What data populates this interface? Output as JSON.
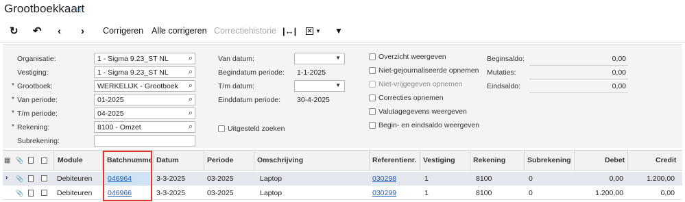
{
  "title": "Grootboekkaart",
  "toolbar": {
    "correct": "Corrigeren",
    "correct_all": "Alle corrigeren",
    "history": "Correctiehistorie"
  },
  "form": {
    "organisatie_label": "Organisatie:",
    "organisatie_value": "1 - Sigma 9.23_ST NL",
    "vestiging_label": "Vestiging:",
    "vestiging_value": "1 - Sigma 9.23_ST NL",
    "grootboek_label": "Grootboek:",
    "grootboek_value": "WERKELIJK - Grootboek",
    "van_periode_label": "Van periode:",
    "van_periode_value": "01-2025",
    "tm_periode_label": "T/m periode:",
    "tm_periode_value": "04-2025",
    "rekening_label": "Rekening:",
    "rekening_value": "8100 - Omzet",
    "subrekening_label": "Subrekening:",
    "subrekening_value": "",
    "van_datum_label": "Van datum:",
    "van_datum_value": "",
    "begindatum_label": "Begindatum periode:",
    "begindatum_value": "1-1-2025",
    "tm_datum_label": "T/m datum:",
    "tm_datum_value": "",
    "einddatum_label": "Einddatum periode:",
    "einddatum_value": "30-4-2025",
    "uitgesteld_label": "Uitgesteld zoeken",
    "overzicht_label": "Overzicht weergeven",
    "niet_gejourn_label": "Niet-gejournaliseerde opnemen",
    "niet_vrij_label": "Niet-vrijgegeven opnemen",
    "correcties_label": "Correcties opnemen",
    "valuta_label": "Valutagegevens weergeven",
    "begin_eind_label": "Begin- en eindsaldo weergeven",
    "beginsaldo_label": "Beginsaldo:",
    "beginsaldo_value": "0,00",
    "mutaties_label": "Mutaties:",
    "mutaties_value": "0,00",
    "eindsaldo_label": "Eindsaldo:",
    "eindsaldo_value": "0,00"
  },
  "grid": {
    "columns": [
      "Module",
      "Batchnumme",
      "Datum",
      "Periode",
      "Omschrijving",
      "Referentienr.",
      "Vestiging",
      "Rekening",
      "Subrekening",
      "Debet",
      "Credit"
    ],
    "rows": [
      {
        "module": "Debiteuren",
        "batch": "046964",
        "datum": "3-3-2025",
        "periode": "03-2025",
        "omschrijving": "Laptop",
        "ref": "030298",
        "vestiging": "1",
        "rekening": "8100",
        "subrekening": "0",
        "debet": "0,00",
        "credit": "1.200,00"
      },
      {
        "module": "Debiteuren",
        "batch": "046966",
        "datum": "3-3-2025",
        "periode": "03-2025",
        "omschrijving": "Laptop",
        "ref": "030299",
        "vestiging": "1",
        "rekening": "8100",
        "subrekening": "0",
        "debet": "1.200,00",
        "credit": "0,00"
      }
    ]
  },
  "icons": {
    "refresh": "refresh-icon",
    "undo": "undo-icon",
    "prev": "chevron-left-icon",
    "next": "chevron-right-icon",
    "fit": "fit-columns-icon",
    "export": "excel-export-icon",
    "filter": "filter-icon",
    "search": "search-icon",
    "star": "star-icon"
  },
  "colors": {
    "link": "#1a5fb4",
    "highlight_box": "#e0342e",
    "selected_row": "#e4e8ee",
    "star": "#2f80d1"
  }
}
